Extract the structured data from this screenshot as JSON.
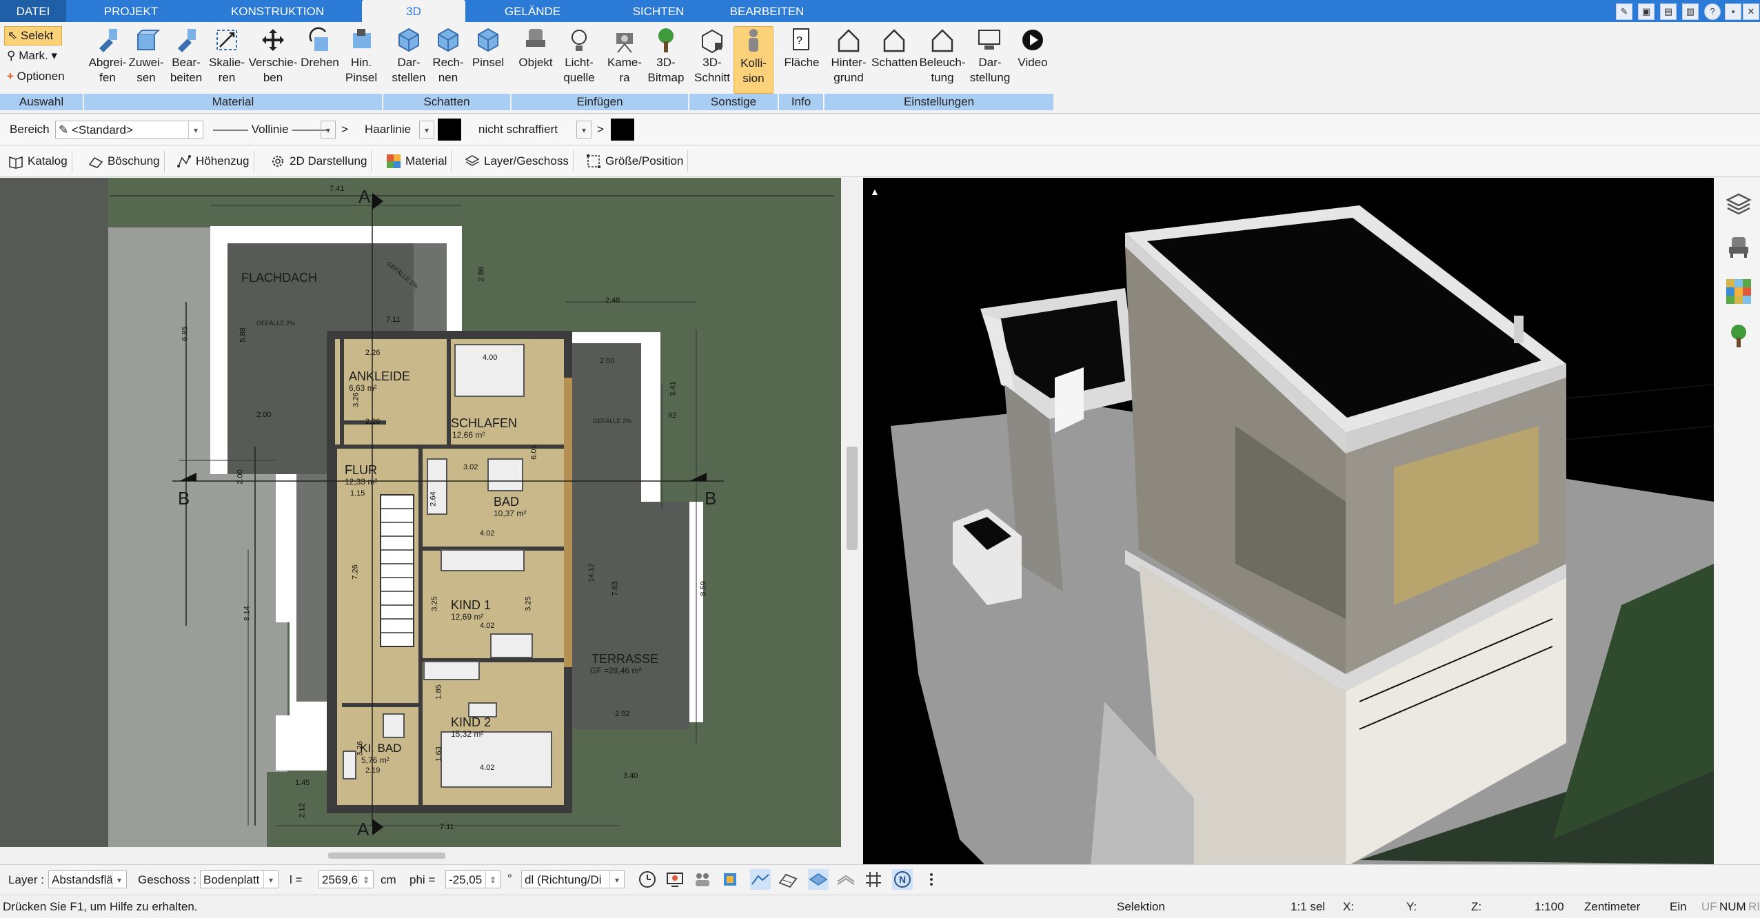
{
  "tabs": [
    {
      "label": "DATEI"
    },
    {
      "label": "PROJEKT"
    },
    {
      "label": "KONSTRUKTION"
    },
    {
      "label": "3D"
    },
    {
      "label": "GELÄNDE"
    },
    {
      "label": "SICHTEN"
    },
    {
      "label": "BEARBEITEN"
    }
  ],
  "window": {
    "help": "?",
    "minimize": "▪",
    "restore": "▫",
    "close": "✕"
  },
  "ribbon": {
    "auswahl": {
      "select": "Selekt",
      "mark": "Mark.",
      "options": "Optionen",
      "group": "Auswahl"
    },
    "material": {
      "group": "Material",
      "buttons": [
        {
          "l1": "Abgrei-",
          "l2": "fen"
        },
        {
          "l1": "Zuwei-",
          "l2": "sen"
        },
        {
          "l1": "Bear-",
          "l2": "beiten"
        },
        {
          "l1": "Skalie-",
          "l2": "ren"
        },
        {
          "l1": "Verschie-",
          "l2": "ben"
        },
        {
          "l1": "Drehen",
          "l2": ""
        },
        {
          "l1": "Hin.",
          "l2": "Pinsel"
        }
      ]
    },
    "schatten": {
      "group": "Schatten",
      "buttons": [
        {
          "l1": "Dar-",
          "l2": "stellen"
        },
        {
          "l1": "Rech-",
          "l2": "nen"
        },
        {
          "l1": "Pinsel",
          "l2": ""
        }
      ]
    },
    "einfuegen": {
      "group": "Einfügen",
      "buttons": [
        {
          "l1": "Objekt",
          "l2": ""
        },
        {
          "l1": "Licht-",
          "l2": "quelle"
        },
        {
          "l1": "Kame-",
          "l2": "ra"
        },
        {
          "l1": "3D-",
          "l2": "Bitmap"
        }
      ]
    },
    "sonstige": {
      "group": "Sonstige",
      "buttons": [
        {
          "l1": "3D-",
          "l2": "Schnitt"
        },
        {
          "l1": "Kolli-",
          "l2": "sion"
        }
      ]
    },
    "info": {
      "group": "Info",
      "buttons": [
        {
          "l1": "Fläche",
          "l2": ""
        }
      ]
    },
    "einstellungen": {
      "group": "Einstellungen",
      "buttons": [
        {
          "l1": "Hinter-",
          "l2": "grund"
        },
        {
          "l1": "Schatten",
          "l2": ""
        },
        {
          "l1": "Beleuch-",
          "l2": "tung"
        },
        {
          "l1": "Dar-",
          "l2": "stellung"
        },
        {
          "l1": "Video",
          "l2": ""
        }
      ]
    }
  },
  "props": {
    "bereich_label": "Bereich",
    "bereich_value": "<Standard>",
    "line_value": "Vollinie",
    "line_gt": ">",
    "thickness_value": "Haarlinie",
    "hatch_value": "nicht schraffiert",
    "hatch_gt": ">",
    "fill_color": "#000000"
  },
  "tools": [
    {
      "label": "Katalog"
    },
    {
      "label": "Böschung"
    },
    {
      "label": "Höhenzug"
    },
    {
      "label": "2D Darstellung"
    },
    {
      "label": "Material"
    },
    {
      "label": "Layer/Geschoss"
    },
    {
      "label": "Größe/Position"
    }
  ],
  "plan": {
    "rooms": [
      {
        "name": "FLACHDACH",
        "area": ""
      },
      {
        "name": "ANKLEIDE",
        "area": "6,63 m²"
      },
      {
        "name": "SCHLAFEN",
        "area": "12,66 m²"
      },
      {
        "name": "FLUR",
        "area": "12,33 m²"
      },
      {
        "name": "BAD",
        "area": "10,37 m²"
      },
      {
        "name": "KIND 1",
        "area": "12,69 m²"
      },
      {
        "name": "TERRASSE",
        "area": "GF =28,46 m²"
      },
      {
        "name": "KIND 2",
        "area": "15,32 m²"
      },
      {
        "name": "KI. BAD",
        "area": "5,76 m²"
      }
    ],
    "section_marks": [
      "A",
      "A",
      "B",
      "B"
    ],
    "dims": [
      "7.41",
      "2.48",
      "6.85",
      "5.88",
      "2.00",
      "2.26",
      "2.26",
      "4.00",
      "3.02",
      "2.64",
      "4.02",
      "4.02",
      "4.02",
      "7.26",
      "8.14",
      "3.25",
      "3.25",
      "14.12",
      "8.59",
      "7.63",
      "3.41",
      "2.00",
      "2.92",
      "3.40",
      "1.45",
      "2.12",
      "2.19",
      "7.11",
      "2.98",
      "7.11",
      "2.00",
      "1.85",
      "1.63",
      "92",
      "6.01",
      "3.26",
      "3.26",
      "1.15"
    ],
    "labels_gefaelle": [
      "GEFÄLLE 2%",
      "GEFÄLLE 2%",
      "GEFÄLLE 2%"
    ]
  },
  "status1": {
    "layer_label": "Layer :",
    "layer_value": "Abstandsflä",
    "geschoss_label": "Geschoss :",
    "geschoss_value": "Bodenplatt",
    "l_label": "l =",
    "l_value": "2569,6",
    "l_unit": "cm",
    "phi_label": "phi =",
    "phi_value": "-25,05",
    "phi_unit": "°",
    "dl_value": "dl (Richtung/Di"
  },
  "status2": {
    "help": "Drücken Sie F1, um Hilfe zu erhalten.",
    "mode": "Selektion",
    "scale_sel": "1:1 sel",
    "x": "X:",
    "y": "Y:",
    "z": "Z:",
    "scale": "1:100",
    "unit": "Zentimeter",
    "ein": "Ein",
    "uf": "UF",
    "num": "NUM",
    "ri": "RI"
  },
  "colors": {
    "tabbar": "#2b7bd6",
    "ribbon_group": "#aacdf3",
    "highlight": "#fbd27a",
    "plan_bg": "#596b54",
    "floor": "#c8b98a"
  }
}
